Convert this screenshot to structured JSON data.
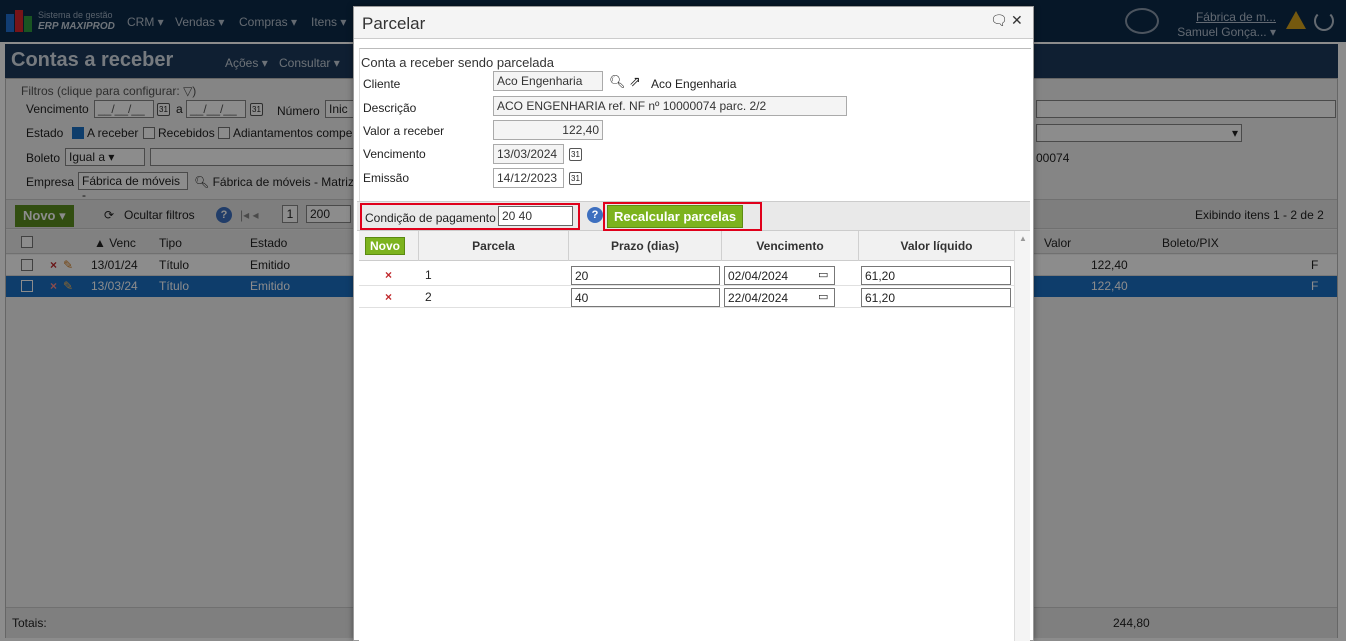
{
  "app": {
    "brand_line1": "Sistema de gestão",
    "brand_line2": "ERP MAXIPROD",
    "menus": [
      "CRM",
      "Vendas",
      "Compras",
      "Itens"
    ],
    "company": "Fábrica de m...",
    "user": "Samuel Gonça..."
  },
  "page": {
    "title": "Contas a receber",
    "actions_menu": "Ações",
    "consult_menu": "Consultar",
    "filters_legend": "Filtros (clique para configurar:",
    "vencimento_label": "Vencimento",
    "date_placeholder": "__/__/__",
    "a_label": "a",
    "numero_label": "Número",
    "numero_value": "Inic",
    "estado_label": "Estado",
    "estado_a_receber": "A receber",
    "estado_recebidos": "Recebidos",
    "estado_adiant": "Adiantamentos compe",
    "boleto_label": "Boleto",
    "boleto_value": "Igual a",
    "empresa_label": "Empresa",
    "empresa_value": "Fábrica de móveis -",
    "empresa_text": "Fábrica de móveis - Matriz",
    "right_text": "00074",
    "novo_button": "Novo",
    "hide_filters": "Ocultar filtros",
    "page_num": "1",
    "page_size": "200",
    "showing": "Exibindo itens 1 - 2 de 2",
    "columns": [
      "Venc",
      "Tipo",
      "Estado",
      "Valor",
      "Boleto/PIX"
    ],
    "rows": [
      {
        "venc": "13/01/24",
        "tipo": "Título",
        "estado": "Emitido",
        "valor": "122,40",
        "extra": "F"
      },
      {
        "venc": "13/03/24",
        "tipo": "Título",
        "estado": "Emitido",
        "valor": "122,40",
        "extra": "F"
      }
    ],
    "totals_label": "Totais:",
    "totals_value": "244,80"
  },
  "dialog": {
    "title": "Parcelar",
    "legend": "Conta a receber sendo parcelada",
    "cliente_label": "Cliente",
    "cliente_value": "Aco Engenharia",
    "cliente_link": "Aco Engenharia",
    "descricao_label": "Descrição",
    "descricao_value": "ACO ENGENHARIA ref. NF nº 10000074 parc. 2/2",
    "valor_label": "Valor a receber",
    "valor_value": "122,40",
    "vencimento_label": "Vencimento",
    "vencimento_value": "13/03/2024",
    "emissao_label": "Emissão",
    "emissao_value": "14/12/2023",
    "condicao_label": "Condição de pagamento",
    "condicao_value": "20 40",
    "recalc_button": "Recalcular parcelas",
    "grid": {
      "novo": "Novo",
      "headers": [
        "Parcela",
        "Prazo (dias)",
        "Vencimento",
        "Valor líquido"
      ],
      "rows": [
        {
          "parcela": "1",
          "prazo": "20",
          "vencimento": "02/04/2024",
          "valor": "61,20"
        },
        {
          "parcela": "2",
          "prazo": "40",
          "vencimento": "22/04/2024",
          "valor": "61,20"
        }
      ]
    }
  },
  "colors": {
    "topbar": "#0b2a4a",
    "accent_green": "#7cb31e",
    "highlight_red": "#e0001b",
    "selected_row": "#1a6fc4"
  }
}
